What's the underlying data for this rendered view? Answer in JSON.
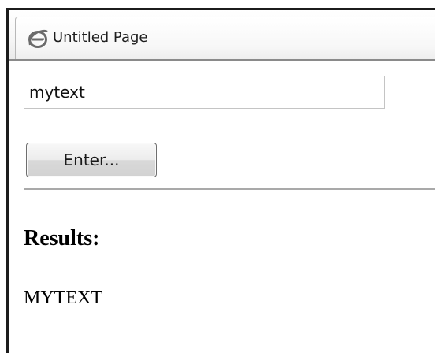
{
  "tab": {
    "icon": "internet-explorer-icon",
    "title": "Untitled Page"
  },
  "form": {
    "input_value": "mytext",
    "button_label": "Enter..."
  },
  "results": {
    "heading": "Results:",
    "value": "MYTEXT"
  },
  "colors": {
    "ie_logo": "#3a78c6",
    "divider": "#a9a9a9",
    "frame_border": "#1c1c1c"
  }
}
